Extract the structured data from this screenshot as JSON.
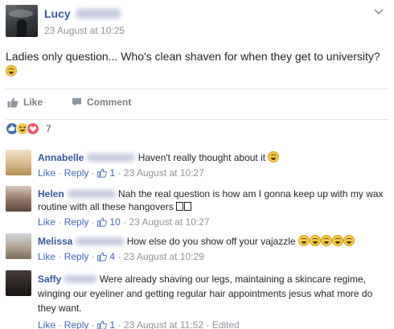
{
  "post": {
    "author": "Lucy",
    "timestamp": "23 August at 10:25",
    "text": "Ladies only question... Who's clean shaven for when they get to university?",
    "like_label": "Like",
    "comment_label": "Comment",
    "reaction_count": "7"
  },
  "comments": [
    {
      "author": "Annabelle",
      "text": "Haven't really thought about it",
      "like": "Like",
      "reply": "Reply",
      "likes": "1",
      "time": "23 August at 10:27",
      "edited": ""
    },
    {
      "author": "Helen",
      "text": "Nah the real question is how am I gonna keep up with my wax routine with all these hangovers",
      "like": "Like",
      "reply": "Reply",
      "likes": "10",
      "time": "23 August at 10:27",
      "edited": ""
    },
    {
      "author": "Melissa",
      "text": "How else do you show off your vajazzle",
      "like": "Like",
      "reply": "Reply",
      "likes": "4",
      "time": "23 August at 10:29",
      "edited": ""
    },
    {
      "author": "Saffy",
      "text": "Were already shaving our legs, maintaining a skincare regime, winging our eyeliner and getting regular hair appointments jesus what more do they want.",
      "like": "Like",
      "reply": "Reply",
      "likes": "1",
      "time": "23 August at 11:52",
      "edited": "Edited"
    }
  ],
  "colors": {
    "link": "#365899",
    "meta": "#90949c",
    "like_blue": "#4267b2"
  }
}
